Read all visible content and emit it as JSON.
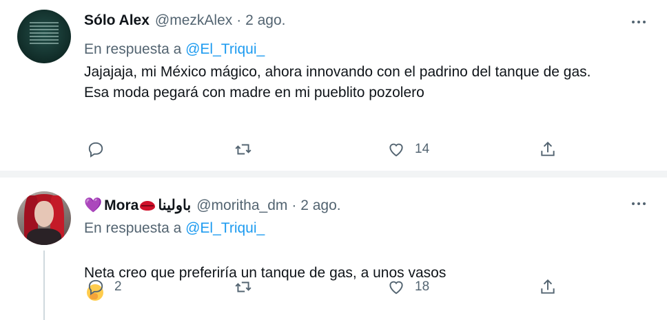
{
  "tweets": [
    {
      "name": "Sólo Alex",
      "handle": "@mezkAlex",
      "time": "· 2 ago.",
      "reply_prefix": "En respuesta a",
      "reply_to": "@El_Triqui_",
      "text": "Jajajaja, mi México mágico, ahora innovando con el padrino del tanque de gas.\nEsa moda pegará con madre en mi pueblito pozolero",
      "reply_count": "",
      "retweet_count": "",
      "like_count": "14"
    },
    {
      "name_prefix_emoji": "💜",
      "name": "Mora",
      "name_suffix": "باولينا",
      "handle": "@moritha_dm",
      "time": "· 2 ago.",
      "reply_prefix": "En respuesta a",
      "reply_to": "@El_Triqui_",
      "text": "Neta creo que preferiría un tanque de gas, a unos vasos",
      "reply_count": "2",
      "retweet_count": "",
      "like_count": "18"
    }
  ],
  "colors": {
    "text": "#0f1419",
    "muted": "#536471",
    "link": "#1d9bf0",
    "divider": "#f2f4f5"
  },
  "icons": [
    "reply-icon",
    "retweet-icon",
    "like-icon",
    "share-icon",
    "more-icon"
  ]
}
